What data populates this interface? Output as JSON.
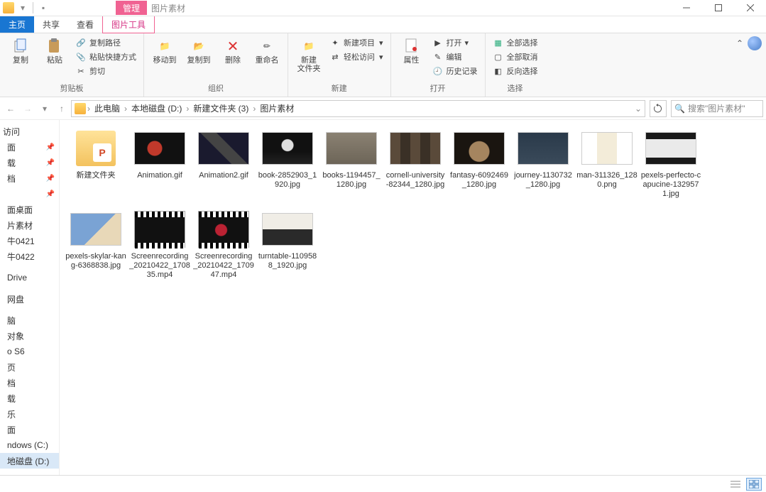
{
  "window": {
    "title": "图片素材",
    "context_tab": "管理",
    "tools_tab": "图片工具"
  },
  "tabs": {
    "home": "主页",
    "share": "共享",
    "view": "查看"
  },
  "ribbon": {
    "clipboard": {
      "label": "剪贴板",
      "copy": "复制",
      "paste": "粘贴",
      "copy_path": "复制路径",
      "paste_shortcut": "粘贴快捷方式",
      "cut": "剪切"
    },
    "organize": {
      "label": "组织",
      "move_to": "移动到",
      "copy_to": "复制到",
      "delete": "删除",
      "rename": "重命名"
    },
    "new": {
      "label": "新建",
      "new_folder": "新建\n文件夹",
      "new_item": "新建项目",
      "easy_access": "轻松访问"
    },
    "open": {
      "label": "打开",
      "properties": "属性",
      "open": "打开",
      "edit": "编辑",
      "history": "历史记录"
    },
    "select": {
      "label": "选择",
      "select_all": "全部选择",
      "deselect": "全部取消",
      "invert": "反向选择"
    }
  },
  "breadcrumb": {
    "items": [
      "此电脑",
      "本地磁盘 (D:)",
      "新建文件夹 (3)",
      "图片素材"
    ]
  },
  "search": {
    "placeholder": "搜索\"图片素材\""
  },
  "sidebar": {
    "quick": "访问",
    "pinned": [
      "面",
      "载",
      "档",
      ""
    ],
    "items": [
      "面桌面",
      "片素材",
      "牛0421",
      "牛0422",
      "Drive",
      "网盘",
      "脑",
      "对象",
      "o S6",
      "页",
      "档",
      "载",
      "乐",
      "面"
    ],
    "drives": [
      "ndows (C:)",
      "地磁盘 (D:)"
    ]
  },
  "files": [
    {
      "name": "新建文件夹",
      "type": "folder"
    },
    {
      "name": "Animation.gif",
      "type": "image"
    },
    {
      "name": "Animation2.gif",
      "type": "image"
    },
    {
      "name": "book-2852903_1920.jpg",
      "type": "image"
    },
    {
      "name": "books-1194457_1280.jpg",
      "type": "image"
    },
    {
      "name": "cornell-university-82344_1280.jpg",
      "type": "image"
    },
    {
      "name": "fantasy-6092469_1280.jpg",
      "type": "image"
    },
    {
      "name": "journey-1130732_1280.jpg",
      "type": "image"
    },
    {
      "name": "man-311326_1280.png",
      "type": "image"
    },
    {
      "name": "pexels-perfecto-capucine-1329571.jpg",
      "type": "image"
    },
    {
      "name": "pexels-skylar-kang-6368838.jpg",
      "type": "image"
    },
    {
      "name": "Screenrecording_20210422_170835.mp4",
      "type": "video"
    },
    {
      "name": "Screenrecording_20210422_170947.mp4",
      "type": "video"
    },
    {
      "name": "turntable-1109588_1920.jpg",
      "type": "image"
    }
  ]
}
